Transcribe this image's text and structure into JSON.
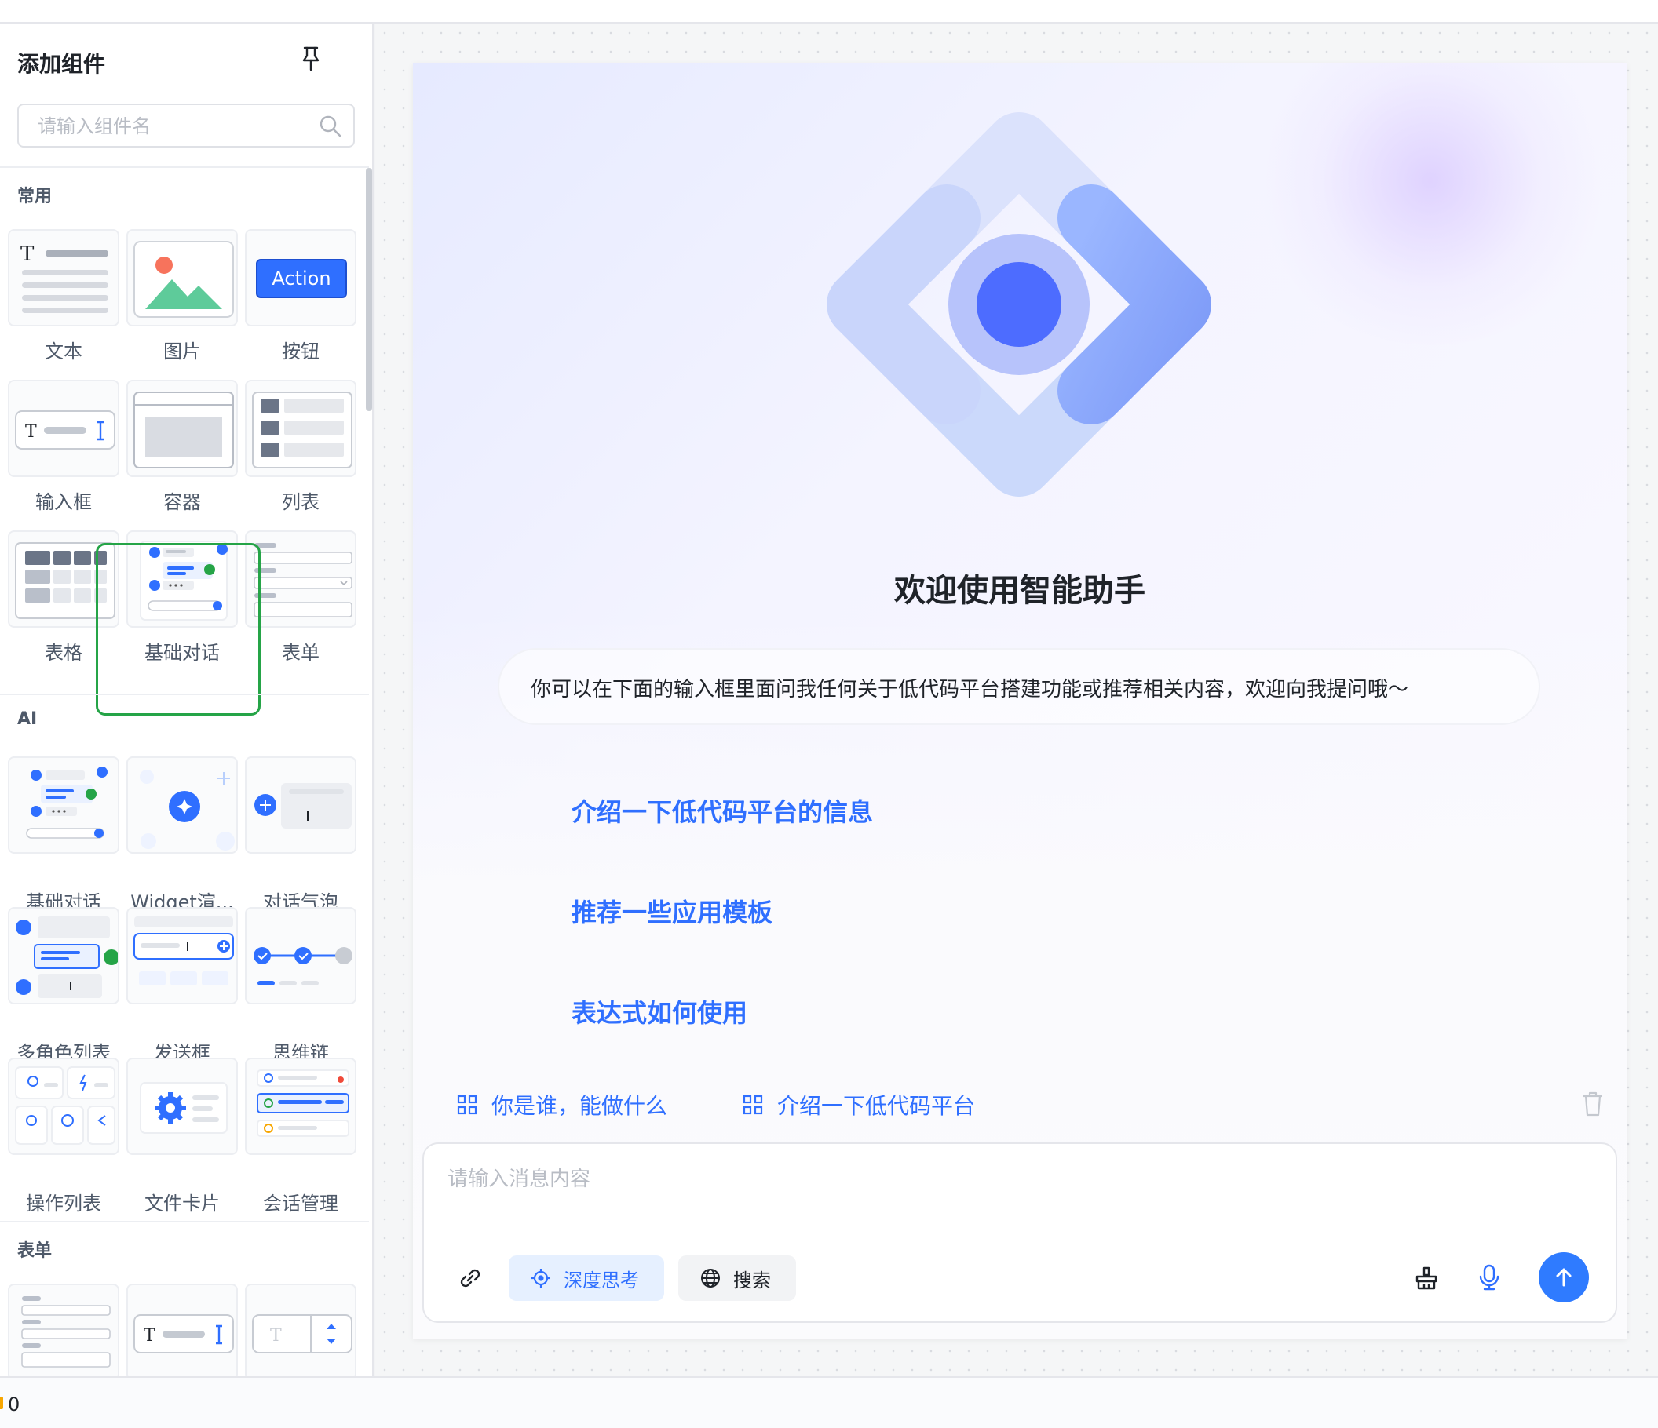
{
  "sidebar": {
    "title": "添加组件",
    "search_placeholder": "请输入组件名",
    "sections": {
      "common": "常用",
      "ai": "AI",
      "form": "表单"
    },
    "common_items": [
      "文本",
      "图片",
      "按钮",
      "输入框",
      "容器",
      "列表",
      "表格",
      "基础对话",
      "表单"
    ],
    "ai_items": [
      "基础对话",
      "Widget渲...",
      "对话气泡",
      "多角色列表",
      "发送框",
      "思维链",
      "操作列表",
      "文件卡片",
      "会话管理"
    ],
    "button_preview_text": "Action"
  },
  "chat": {
    "welcome_title": "欢迎使用智能助手",
    "description": "你可以在下面的输入框里面问我任何关于低代码平台搭建功能或推荐相关内容，欢迎向我提问哦～",
    "suggestions": [
      "介绍一下低代码平台的信息",
      "推荐一些应用模板",
      "表达式如何使用"
    ],
    "quick_prompts": [
      "你是谁，能做什么",
      "介绍一下低代码平台"
    ],
    "input_placeholder": "请输入消息内容",
    "deep_think_label": "深度思考",
    "search_label": "搜索"
  },
  "status": {
    "count": "0"
  },
  "colors": {
    "accent": "#2f7bff",
    "highlight": "#25a447"
  }
}
